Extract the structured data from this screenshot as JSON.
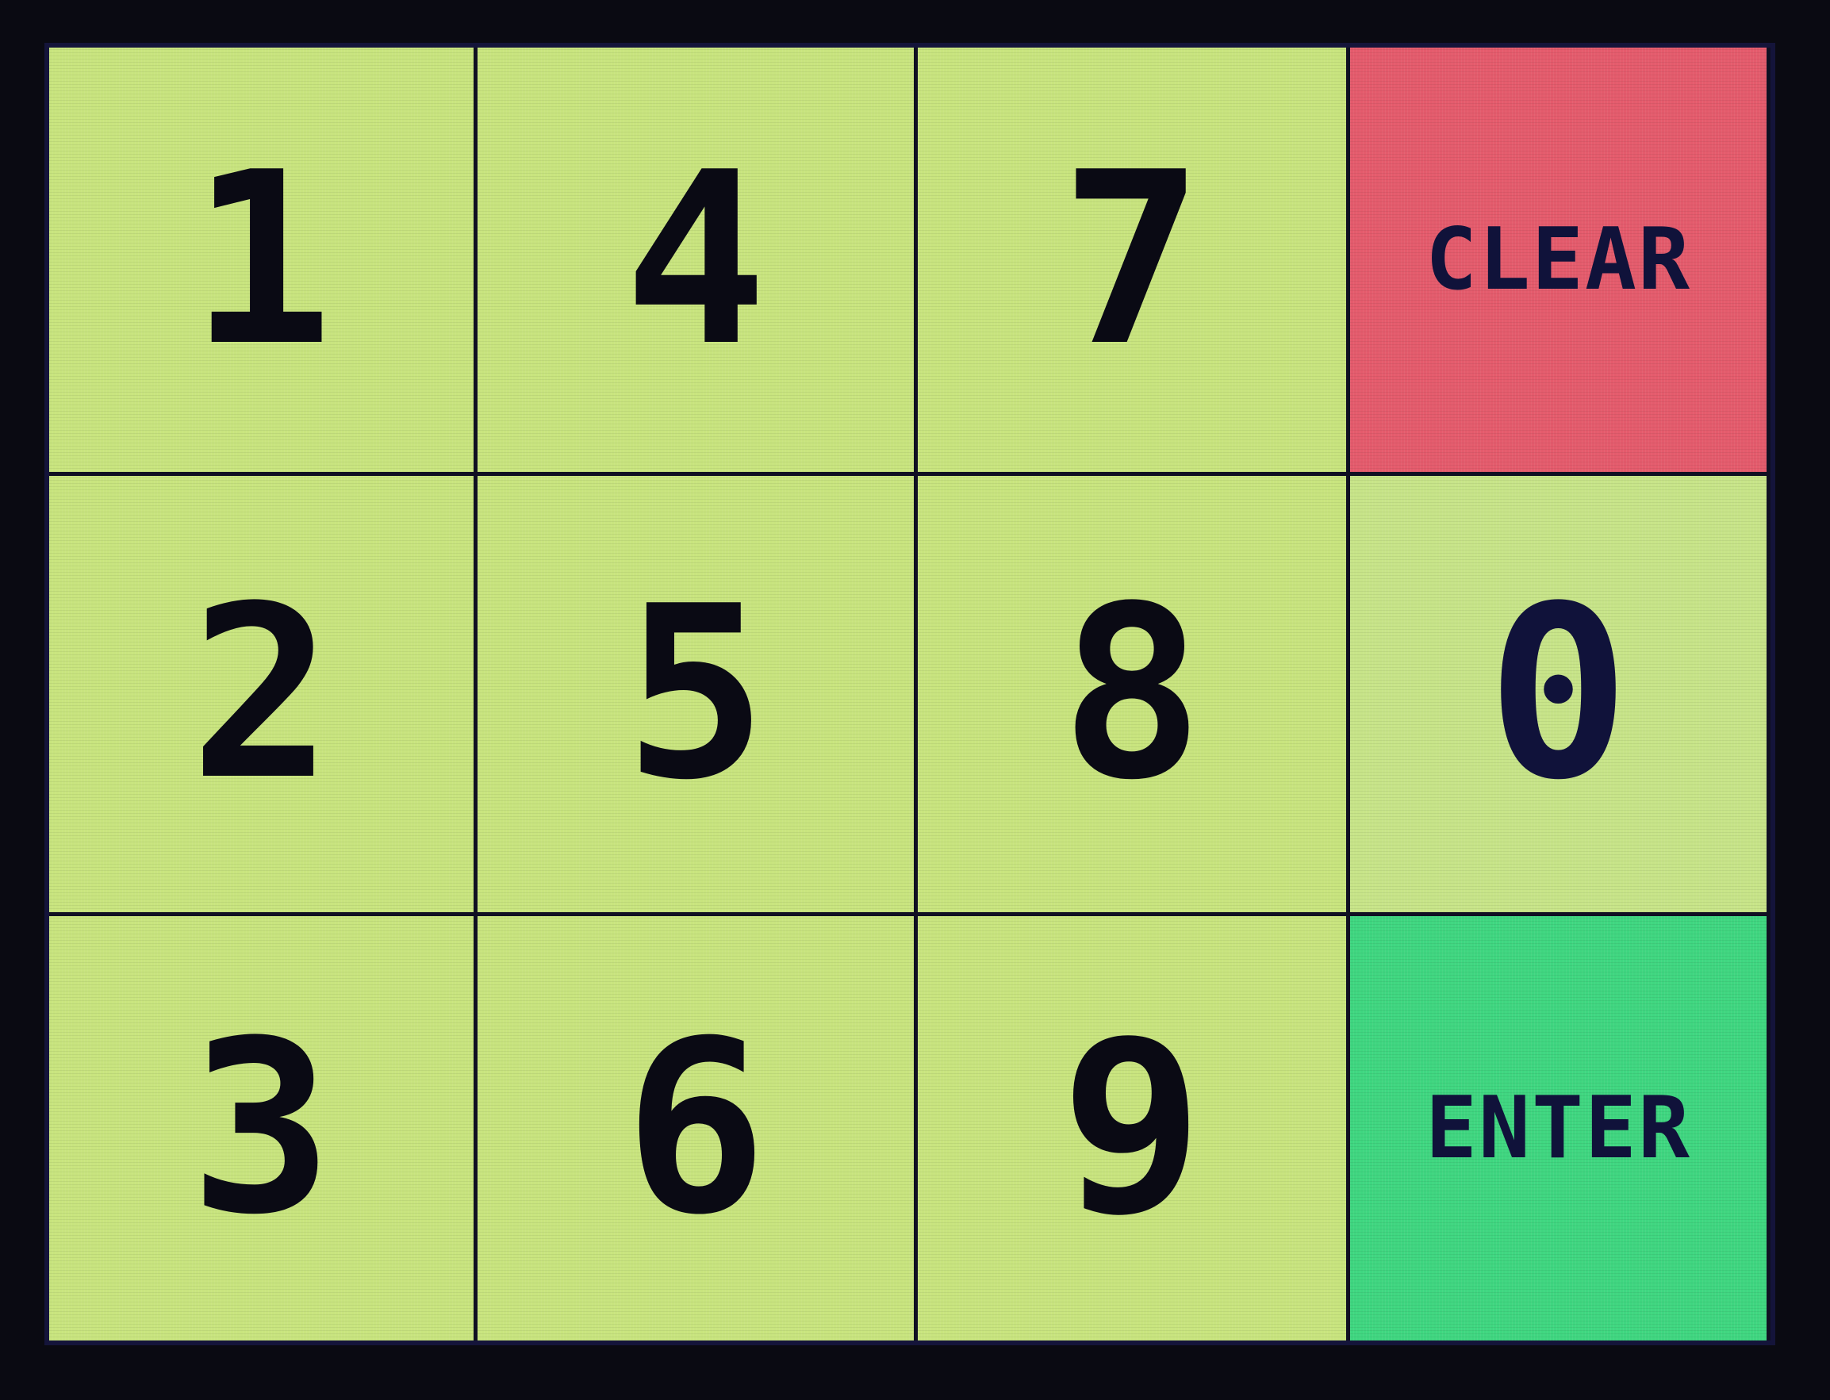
{
  "keypad": {
    "row1": {
      "key_1": "1",
      "key_4": "4",
      "key_7": "7",
      "clear": "CLEAR"
    },
    "row2": {
      "key_2": "2",
      "key_5": "5",
      "key_8": "8",
      "key_0": "0"
    },
    "row3": {
      "key_3": "3",
      "key_6": "6",
      "key_9": "9",
      "enter": "ENTER"
    }
  },
  "colors": {
    "key_background": "#c8e47e",
    "clear_background": "#e45b6c",
    "enter_background": "#3fd680",
    "text": "#0a0a14",
    "frame": "#0a0a12"
  }
}
